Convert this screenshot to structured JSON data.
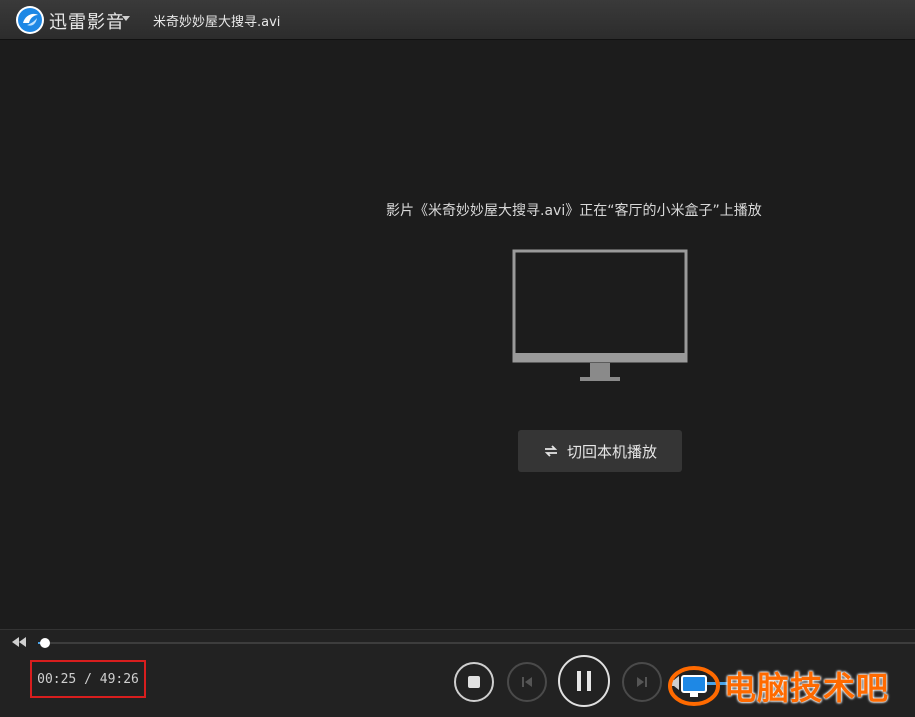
{
  "titlebar": {
    "app_name": "迅雷影音",
    "file_title": "米奇妙妙屋大搜寻.avi"
  },
  "video": {
    "status_text": "影片《米奇妙妙屋大搜寻.avi》正在“客厅的小米盒子”上播放",
    "switch_button_label": "切回本机播放"
  },
  "controls": {
    "time_display": "00:25 / 49:26",
    "progress_fraction": 0.008,
    "icons": {
      "rewind": "rewind-icon",
      "stop": "stop-icon",
      "previous": "skip-previous-icon",
      "pause": "pause-icon",
      "next": "skip-next-icon",
      "volume": "volume-icon"
    }
  },
  "watermark": {
    "text": "电脑技术吧"
  },
  "colors": {
    "accent": "#4aa3e8",
    "highlight_box": "#d81e1e",
    "watermark": "#ff6a00"
  }
}
